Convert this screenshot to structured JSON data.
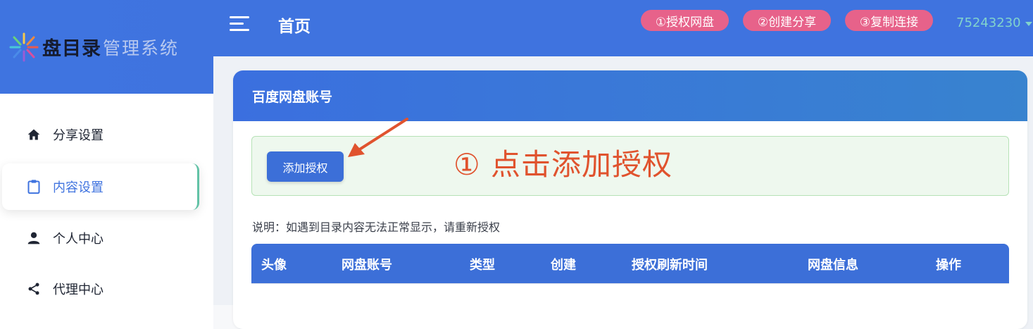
{
  "sidebar": {
    "logo_title": "盘目录",
    "logo_sub": "管理系统",
    "items": [
      {
        "label": "分享设置",
        "icon": "home-icon",
        "active": false
      },
      {
        "label": "内容设置",
        "icon": "clipboard-icon",
        "active": true
      },
      {
        "label": "个人中心",
        "icon": "person-icon",
        "active": false
      },
      {
        "label": "代理中心",
        "icon": "share-icon",
        "active": false
      }
    ]
  },
  "header": {
    "title": "首页",
    "pills": [
      "①授权网盘",
      "②创建分享",
      "③复制连接"
    ],
    "user_id": "75243230"
  },
  "card": {
    "title": "百度网盘账号",
    "add_button": "添加授权",
    "annotation": "① 点击添加授权",
    "note": "说明：如遇到目录内容无法正常显示，请重新授权",
    "columns": [
      "头像",
      "网盘账号",
      "类型",
      "创建",
      "授权刷新时间",
      "网盘信息",
      "操作"
    ]
  },
  "colors": {
    "primary": "#3f73df",
    "pill": "#e7628a",
    "annotation": "#e0532e",
    "active_text": "#3f73df"
  }
}
